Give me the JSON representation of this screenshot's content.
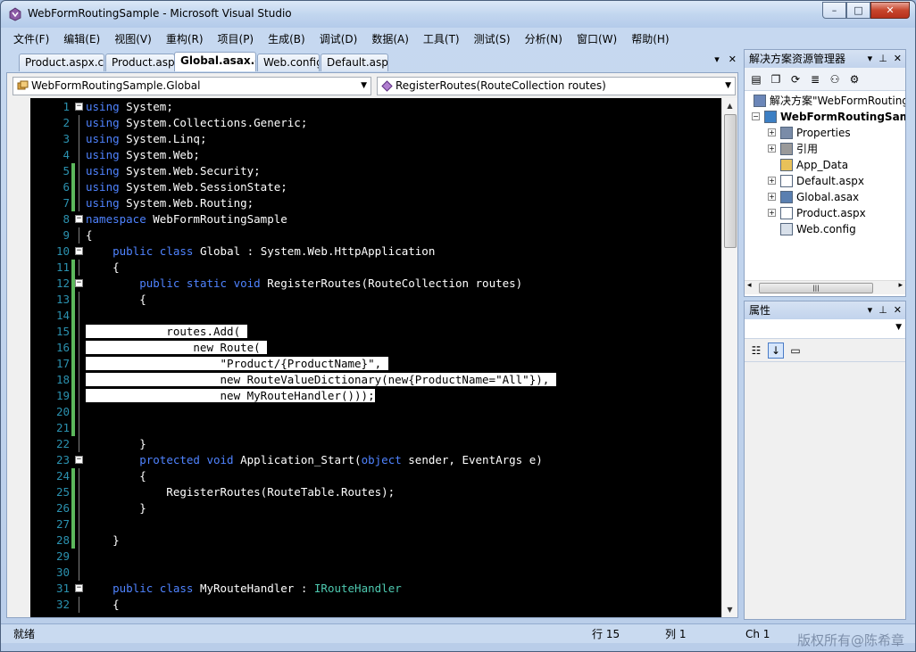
{
  "window": {
    "title": "WebFormRoutingSample - Microsoft Visual Studio",
    "controls": {
      "minimize": "–",
      "maximize": "□",
      "close": "✕"
    }
  },
  "menu": [
    "文件(F)",
    "编辑(E)",
    "视图(V)",
    "重构(R)",
    "项目(P)",
    "生成(B)",
    "调试(D)",
    "数据(A)",
    "工具(T)",
    "测试(S)",
    "分析(N)",
    "窗口(W)",
    "帮助(H)"
  ],
  "tabs": [
    "Product.aspx.cs",
    "Product.aspx",
    "Global.asax.cs*",
    "Web.config",
    "Default.aspx"
  ],
  "tab_tools": {
    "dropdown": "▾",
    "close": "✕"
  },
  "editor": {
    "class_combo": "WebFormRoutingSample.Global",
    "member_combo": "RegisterRoutes(RouteCollection routes)",
    "lines": [
      {
        "n": "1",
        "segs": [
          [
            "kw",
            "using"
          ],
          [
            "",
            "System;"
          ]
        ]
      },
      {
        "n": "2",
        "segs": [
          [
            "kw",
            "using"
          ],
          [
            "",
            "System.Collections.Generic;"
          ]
        ]
      },
      {
        "n": "3",
        "segs": [
          [
            "kw",
            "using"
          ],
          [
            "",
            "System.Linq;"
          ]
        ]
      },
      {
        "n": "4",
        "segs": [
          [
            "kw",
            "using"
          ],
          [
            "",
            "System.Web;"
          ]
        ]
      },
      {
        "n": "5",
        "segs": [
          [
            "kw",
            "using"
          ],
          [
            "",
            "System.Web.Security;"
          ]
        ]
      },
      {
        "n": "6",
        "segs": [
          [
            "kw",
            "using"
          ],
          [
            "",
            "System.Web.SessionState;"
          ]
        ]
      },
      {
        "n": "7",
        "segs": [
          [
            "kw",
            "using"
          ],
          [
            "",
            "System.Web.Routing;"
          ]
        ]
      },
      {
        "n": "8",
        "segs": [
          [
            "kw",
            "namespace"
          ],
          [
            "",
            "WebFormRoutingSample"
          ]
        ]
      },
      {
        "n": "9",
        "segs": [
          [
            "",
            "{"
          ]
        ]
      },
      {
        "n": "10",
        "segs": [
          [
            "",
            "    "
          ],
          [
            "kw",
            "public"
          ],
          [
            "",
            ""
          ],
          [
            "kw",
            "class"
          ],
          [
            "",
            "Global : System.Web.HttpApplication"
          ]
        ]
      },
      {
        "n": "11",
        "segs": [
          [
            "",
            "    {"
          ]
        ]
      },
      {
        "n": "12",
        "segs": [
          [
            "",
            "        "
          ],
          [
            "kw",
            "public"
          ],
          [
            "",
            ""
          ],
          [
            "kw",
            "static"
          ],
          [
            "",
            ""
          ],
          [
            "kw",
            "void"
          ],
          [
            "",
            "RegisterRoutes(RouteCollection routes)"
          ]
        ]
      },
      {
        "n": "13",
        "segs": [
          [
            "",
            "        {"
          ]
        ]
      },
      {
        "n": "14",
        "segs": []
      },
      {
        "n": "15",
        "segs": [
          [
            "sel",
            "            routes.Add( "
          ]
        ]
      },
      {
        "n": "16",
        "segs": [
          [
            "sel",
            "                new Route( "
          ]
        ]
      },
      {
        "n": "17",
        "segs": [
          [
            "sel",
            "                    \"Product/{ProductName}\", "
          ]
        ]
      },
      {
        "n": "18",
        "segs": [
          [
            "sel",
            "                    new RouteValueDictionary(new{ProductName=\"All\"}), "
          ]
        ]
      },
      {
        "n": "19",
        "segs": [
          [
            "sel",
            "                    new MyRouteHandler()));"
          ]
        ]
      },
      {
        "n": "20",
        "segs": []
      },
      {
        "n": "21",
        "segs": []
      },
      {
        "n": "22",
        "segs": [
          [
            "",
            "        }"
          ]
        ]
      },
      {
        "n": "23",
        "segs": [
          [
            "",
            "        "
          ],
          [
            "kw",
            "protected"
          ],
          [
            "",
            ""
          ],
          [
            "kw",
            "void"
          ],
          [
            "",
            "Application_Start("
          ],
          [
            "kw",
            "object"
          ],
          [
            "",
            "sender, EventArgs e)"
          ]
        ]
      },
      {
        "n": "24",
        "segs": [
          [
            "",
            "        {"
          ]
        ]
      },
      {
        "n": "25",
        "segs": [
          [
            "",
            "            RegisterRoutes(RouteTable.Routes);"
          ]
        ]
      },
      {
        "n": "26",
        "segs": [
          [
            "",
            "        }"
          ]
        ]
      },
      {
        "n": "27",
        "segs": []
      },
      {
        "n": "28",
        "segs": [
          [
            "",
            "    }"
          ]
        ]
      },
      {
        "n": "29",
        "segs": []
      },
      {
        "n": "30",
        "segs": []
      },
      {
        "n": "31",
        "segs": [
          [
            "",
            "    "
          ],
          [
            "kw",
            "public"
          ],
          [
            "",
            ""
          ],
          [
            "kw",
            "class"
          ],
          [
            "",
            "MyRouteHandler : "
          ],
          [
            "ty",
            "IRouteHandler"
          ]
        ]
      },
      {
        "n": "32",
        "segs": [
          [
            "",
            "    {"
          ]
        ]
      }
    ]
  },
  "solution_explorer": {
    "title": "解决方案资源管理器",
    "header_tools": {
      "dropdown": "▾",
      "pin": "⊥",
      "close": "✕"
    },
    "items": [
      {
        "label": "解决方案\"WebFormRoutingSample\"",
        "icon": "solution-icon",
        "expander": "",
        "bold": false
      },
      {
        "label": "WebFormRoutingSample",
        "icon": "web-project-icon",
        "expander": "−",
        "bold": true
      },
      {
        "label": "Properties",
        "icon": "properties-icon",
        "expander": "+",
        "bold": false
      },
      {
        "label": "引用",
        "icon": "references-icon",
        "expander": "+",
        "bold": false
      },
      {
        "label": "App_Data",
        "icon": "folder-icon",
        "expander": "",
        "bold": false
      },
      {
        "label": "Default.aspx",
        "icon": "aspx-file-icon",
        "expander": "+",
        "bold": false
      },
      {
        "label": "Global.asax",
        "icon": "asax-file-icon",
        "expander": "+",
        "bold": false
      },
      {
        "label": "Product.aspx",
        "icon": "aspx-file-icon",
        "expander": "+",
        "bold": false
      },
      {
        "label": "Web.config",
        "icon": "config-file-icon",
        "expander": "",
        "bold": false
      }
    ],
    "scroll_left": "◂",
    "scroll_right": "▸",
    "scroll_grip": "|||"
  },
  "properties": {
    "title": "属性",
    "header_tools": {
      "dropdown": "▾",
      "pin": "⊥",
      "close": "✕"
    }
  },
  "status": {
    "ready": "就绪",
    "line": "行 15",
    "col": "列 1",
    "ch": "Ch 1"
  },
  "watermark": "版权所有@陈希章"
}
